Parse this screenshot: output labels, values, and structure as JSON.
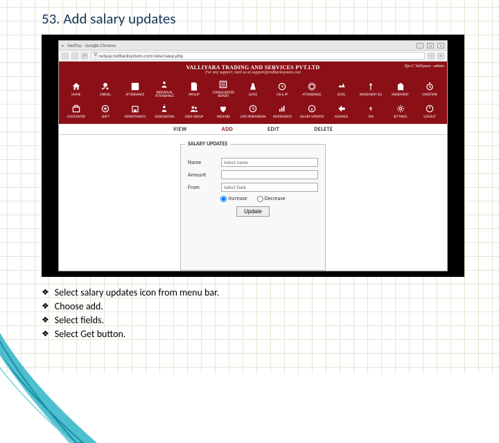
{
  "slide": {
    "title": "53. Add salary updates",
    "bullets": [
      "Select salary updates icon from menu bar.",
      "Choose add.",
      "Select fields.",
      "Select Get button."
    ]
  },
  "browser": {
    "window_title": "NetPay - Google Chrome",
    "url": "netpay.redbacksystem.com/view/saup.php",
    "winbtns": {
      "min": "−",
      "max": "□",
      "close": "×"
    }
  },
  "app": {
    "company": "VALLIYARA TRADING AND SERVICES PVT.LTD",
    "support": "For any support, mail us at support@redbacksystem.com",
    "user": "Jijo C Valliyara - admin",
    "menu_row1": [
      {
        "name": "home",
        "label": "HOME"
      },
      {
        "name": "enroll",
        "label": "ENROLL"
      },
      {
        "name": "attendance",
        "label": "ATTENDANCE"
      },
      {
        "name": "individual",
        "label": "INDIVIDUAL ATTENDANCE"
      },
      {
        "name": "payslip",
        "label": "PAYSLIP"
      },
      {
        "name": "consolidated",
        "label": "CONSOLIDATED REPORT"
      },
      {
        "name": "leave",
        "label": "LEAVE"
      },
      {
        "name": "esi",
        "label": "ESI & PF"
      },
      {
        "name": "welfare-top",
        "label": "ATTENDANCE"
      },
      {
        "name": "level",
        "label": "LEVEL"
      },
      {
        "name": "increment-top",
        "label": "INCREMENT ICS"
      },
      {
        "name": "fine",
        "label": "INCREMENT"
      },
      {
        "name": "overtime",
        "label": "OVERTIME"
      }
    ],
    "menu_row2": [
      {
        "name": "costcenter",
        "label": "COSTCENTER"
      },
      {
        "name": "shift",
        "label": "SHIFT"
      },
      {
        "name": "departments",
        "label": "DEPARTMENTS"
      },
      {
        "name": "designation",
        "label": "DESIGNATION"
      },
      {
        "name": "usergroup",
        "label": "USER GROUP"
      },
      {
        "name": "welfare",
        "label": "WELFARE"
      },
      {
        "name": "latepermission",
        "label": "LATE PERMISSION"
      },
      {
        "name": "increments",
        "label": "INCREMENTS"
      },
      {
        "name": "salaryupdates",
        "label": "SALARY UPDATES"
      },
      {
        "name": "advance",
        "label": "ADVANCE"
      },
      {
        "name": "tax",
        "label": "TAX"
      },
      {
        "name": "settings",
        "label": "SETTINGS"
      },
      {
        "name": "logout",
        "label": "LOGOUT"
      }
    ],
    "tabs": [
      "VIEW",
      "ADD",
      "EDIT",
      "DELETE"
    ],
    "active_tab": "ADD",
    "form": {
      "legend": "SALARY UPDATES",
      "name_label": "Name",
      "name_placeholder": "Select name",
      "amount_label": "Amount",
      "amount_value": "",
      "from_label": "From",
      "from_placeholder": "Select Date",
      "increase_label": "Increase",
      "decrease_label": "Decrease",
      "submit": "Update"
    }
  }
}
